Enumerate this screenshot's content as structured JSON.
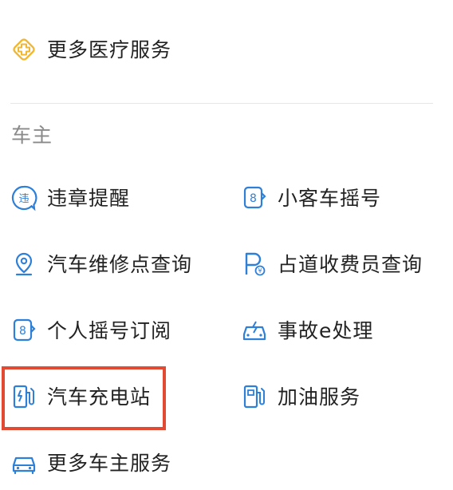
{
  "top": {
    "more_medical": {
      "label": "更多医疗服务",
      "icon": "medical-plus-icon"
    }
  },
  "section": {
    "title": "车主"
  },
  "items": [
    {
      "label": "违章提醒",
      "icon": "violation-icon"
    },
    {
      "label": "小客车摇号",
      "icon": "lottery-number-icon"
    },
    {
      "label": "汽车维修点查询",
      "icon": "location-pin-icon"
    },
    {
      "label": "占道收费员查询",
      "icon": "parking-icon"
    },
    {
      "label": "个人摇号订阅",
      "icon": "lottery-subscribe-icon"
    },
    {
      "label": "事故e处理",
      "icon": "accident-car-icon"
    },
    {
      "label": "汽车充电站",
      "icon": "charging-station-icon"
    },
    {
      "label": "加油服务",
      "icon": "fuel-pump-icon"
    },
    {
      "label": "更多车主服务",
      "icon": "car-icon"
    }
  ],
  "colors": {
    "icon_blue": "#2e7fd8",
    "icon_yellow": "#f2b731",
    "highlight_border": "#e24a33",
    "section_gray": "#8a8a8a"
  }
}
